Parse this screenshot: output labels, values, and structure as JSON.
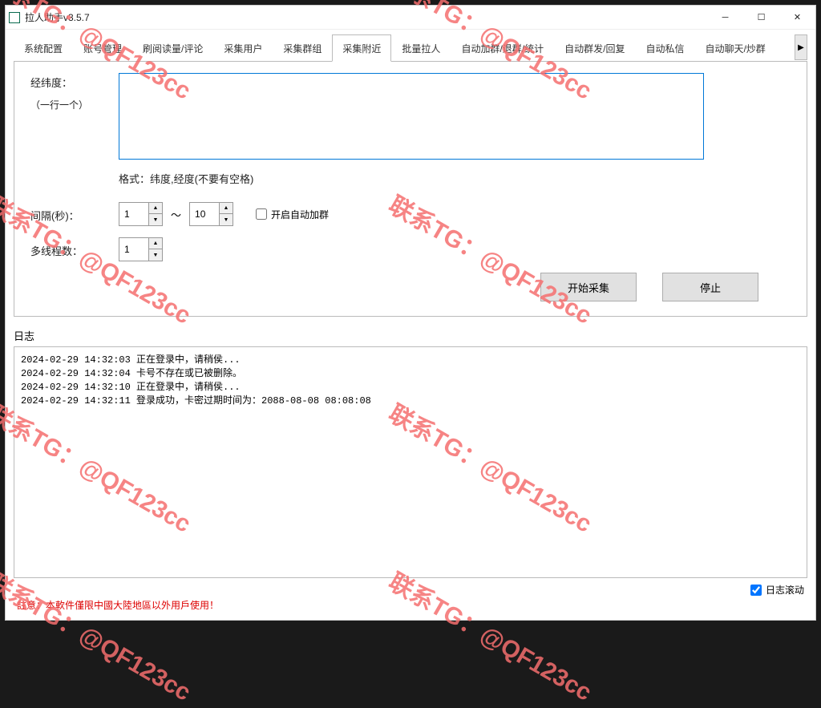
{
  "window": {
    "title": "拉人助手v3.5.7"
  },
  "tabs": {
    "items": [
      "系统配置",
      "账号管理",
      "刷阅读量/评论",
      "采集用户",
      "采集群组",
      "采集附近",
      "批量拉人",
      "自动加群/退群/统计",
      "自动群发/回复",
      "自动私信",
      "自动聊天/炒群"
    ],
    "active_index": 5
  },
  "form": {
    "coords_label": "经纬度：",
    "coords_sublabel": "（一行一个）",
    "coords_value": "",
    "format_hint": "格式：纬度,经度(不要有空格)",
    "interval_label": "间隔(秒)：",
    "interval_min": "1",
    "interval_max": "10",
    "auto_join_label": "开启自动加群",
    "threads_label": "多线程数：",
    "threads_value": "1",
    "start_btn": "开始采集",
    "stop_btn": "停止"
  },
  "log": {
    "label": "日志",
    "scroll_label": "日志滚动",
    "lines": [
      "2024-02-29 14:32:03 正在登录中，请稍侯...",
      "2024-02-29 14:32:04 卡号不存在或已被删除。",
      "2024-02-29 14:32:10 正在登录中，请稍侯...",
      "2024-02-29 14:32:11 登录成功，卡密过期时间为：2088-08-08 08:08:08"
    ]
  },
  "disclaimer": "註意：本軟件僅限中國大陸地區以外用戶使用！",
  "watermark": "联系TG：@QF123cc"
}
